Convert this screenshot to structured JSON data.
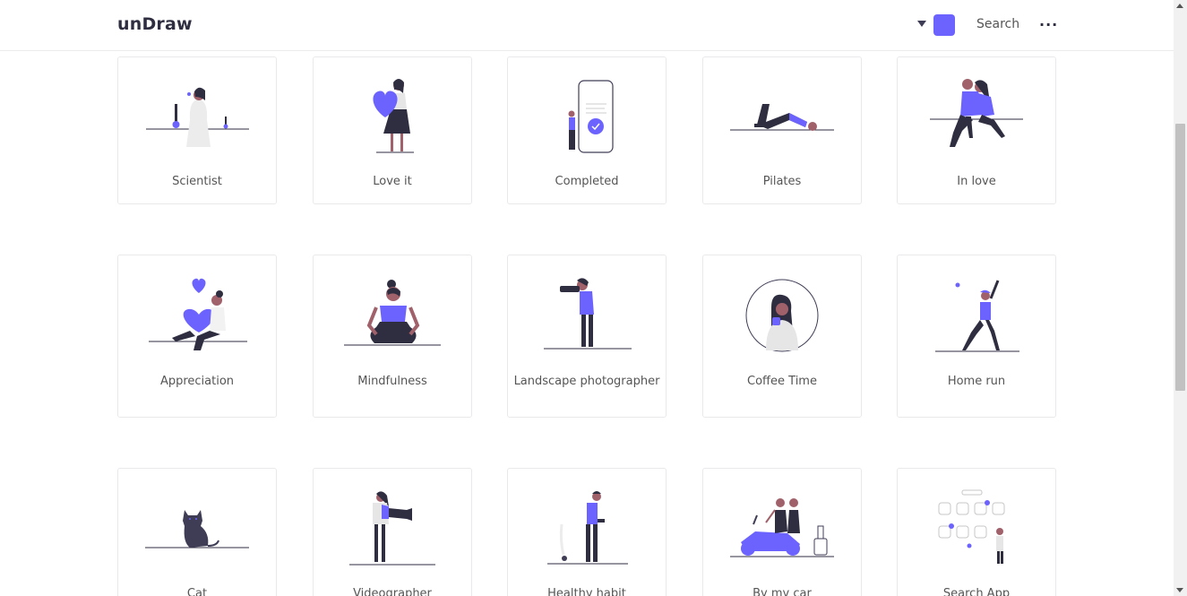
{
  "header": {
    "logo": "unDraw",
    "accent_color": "#6c63ff",
    "search_label": "Search",
    "more_label": "···"
  },
  "illustrations": [
    {
      "title": "Scientist"
    },
    {
      "title": "Love it"
    },
    {
      "title": "Completed"
    },
    {
      "title": "Pilates"
    },
    {
      "title": "In love"
    },
    {
      "title": "Appreciation"
    },
    {
      "title": "Mindfulness"
    },
    {
      "title": "Landscape photographer"
    },
    {
      "title": "Coffee Time"
    },
    {
      "title": "Home run"
    },
    {
      "title": "Cat"
    },
    {
      "title": "Videographer"
    },
    {
      "title": "Healthy habit"
    },
    {
      "title": "By my car"
    },
    {
      "title": "Search App"
    }
  ]
}
